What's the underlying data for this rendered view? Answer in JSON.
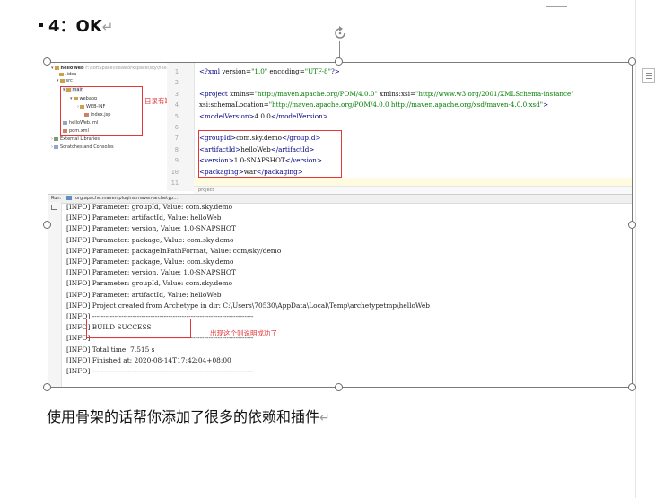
{
  "document": {
    "heading": "4：OK",
    "paragraph_mark": "↵",
    "caption": "使用骨架的话帮你添加了很多的依赖和插件"
  },
  "ide": {
    "tree": {
      "project": "helloWeb",
      "project_path": "F:\\softSpace\\ideaworkspace\\sky\\helloWeb",
      "items": [
        {
          "label": ".idea",
          "icon": "folder-icon"
        },
        {
          "label": "src",
          "icon": "folder-icon"
        },
        {
          "label": "main",
          "icon": "folder-icon"
        },
        {
          "label": "webapp",
          "icon": "folder-icon"
        },
        {
          "label": "WEB-INF",
          "icon": "folder-icon"
        },
        {
          "label": "index.jsp",
          "icon": "jsp-file-icon"
        },
        {
          "label": "helloWeb.iml",
          "icon": "iml-file-icon"
        },
        {
          "label": "pom.xml",
          "icon": "xml-file-icon"
        },
        {
          "label": "External Libraries",
          "icon": "library-icon"
        },
        {
          "label": "Scratches and Consoles",
          "icon": "scratch-icon"
        }
      ],
      "annotation": "目录有缺失"
    },
    "editor": {
      "line_numbers": [
        "1",
        "2",
        "3",
        "4",
        "5",
        "6",
        "7",
        "8",
        "9",
        "10",
        "11"
      ],
      "lines": [
        "<?xml version=\"1.0\" encoding=\"UTF-8\"?>",
        "",
        "<project xmlns=\"http://maven.apache.org/POM/4.0.0\" xmlns:xsi=\"http://www.w3.org/2001/XMLSchema-instance\"",
        "  xsi:schemaLocation=\"http://maven.apache.org/POM/4.0.0 http://maven.apache.org/xsd/maven-4.0.0.xsd\">",
        "  <modelVersion>4.0.0</modelVersion>",
        "",
        "  <groupId>com.sky.demo</groupId>",
        "  <artifactId>helloWeb</artifactId>",
        "  <version>1.0-SNAPSHOT</version>",
        "  <packaging>war</packaging>",
        ""
      ],
      "breadcrumb": "project"
    },
    "run": {
      "tab_label": "Run:",
      "run_config": "org.apache.maven.plugins:maven-archetyp...",
      "console": [
        "[INFO] Parameter: groupId, Value: com.sky.demo",
        "[INFO] Parameter: artifactId, Value: helloWeb",
        "[INFO] Parameter: version, Value: 1.0-SNAPSHOT",
        "[INFO] Parameter: package, Value: com.sky.demo",
        "[INFO] Parameter: packageInPathFormat, Value: com/sky/demo",
        "[INFO] Parameter: package, Value: com.sky.demo",
        "[INFO] Parameter: version, Value: 1.0-SNAPSHOT",
        "[INFO] Parameter: groupId, Value: com.sky.demo",
        "[INFO] Parameter: artifactId, Value: helloWeb",
        "[INFO] Project created from Archetype in dir: C:\\Users\\70530\\AppData\\Local\\Temp\\archetypetmp\\helloWeb",
        "[INFO] ------------------------------------------------------------------------",
        "[INFO] BUILD SUCCESS",
        "[INFO] ------------------------------------------------------------------------",
        "[INFO] Total time:  7.515 s",
        "[INFO] Finished at: 2020-08-14T17:42:04+08:00",
        "[INFO] ------------------------------------------------------------------------"
      ],
      "annotation": "出现这个则说明成功了"
    }
  },
  "colors": {
    "annotation_red": "#e23838",
    "xml_tag": "#000080",
    "xml_string": "#007d00"
  }
}
